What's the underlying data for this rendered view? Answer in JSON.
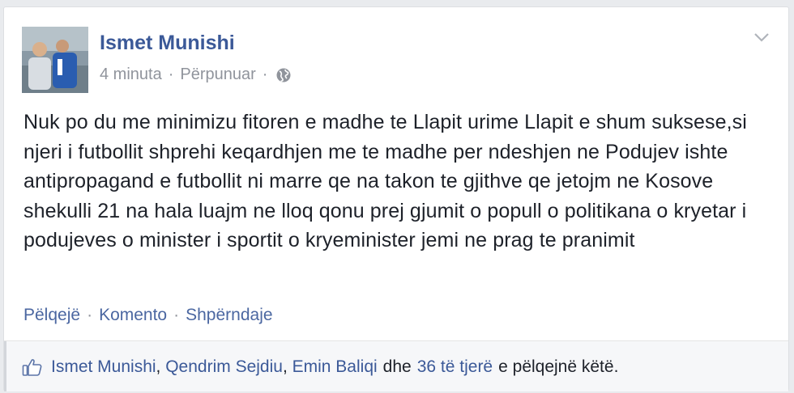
{
  "post": {
    "author": "Ismet Munishi",
    "time": "4 minuta",
    "edited": "Përpunuar",
    "privacy_icon": "globe-icon",
    "text": "Nuk po du me minimizu fitoren e madhe te Llapit urime Llapit e shum suksese,si njeri i futbollit shprehi keqardhjen me te madhe per ndeshjen ne Podujev ishte antipropagand e futbollit ni marre qe na takon te gjithve qe jetojm ne Kosove shekulli 21 na hala luajm ne lloq qonu prej gjumit o popull o politikana o kryetar i podujeves o minister i sportit o kryeminister jemi ne prag te pranimit",
    "actions": {
      "like": "Pëlqejë",
      "comment": "Komento",
      "share": "Shpërndaje"
    },
    "likes": {
      "names": [
        "Ismet Munishi",
        "Qendrim Sejdiu",
        "Emin Baliqi"
      ],
      "sep": ", ",
      "and": "dhe",
      "others": "36 të tjerë",
      "suffix": "e pëlqejnë këtë."
    }
  },
  "colors": {
    "link": "#3b5998",
    "muted": "#90949c",
    "background": "#e9ebee"
  }
}
